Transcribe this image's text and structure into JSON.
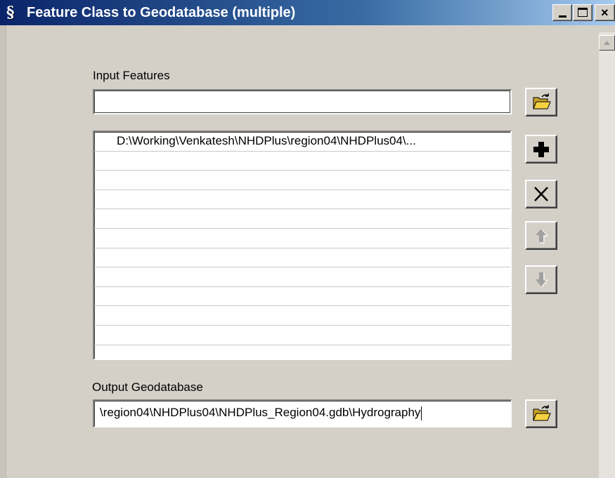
{
  "window": {
    "title": "Feature Class to Geodatabase (multiple)",
    "app_icon": "script-tool-icon",
    "controls": [
      "minimize",
      "maximize",
      "close"
    ]
  },
  "input_features": {
    "label": "Input Features",
    "value": "",
    "browse_icon": "open-folder-icon"
  },
  "features_list": {
    "items": [
      "D:\\Working\\Venkatesh\\NHDPlus\\region04\\NHDPlus04\\...",
      "",
      "",
      "",
      "",
      "",
      "",
      "",
      "",
      "",
      "",
      ""
    ]
  },
  "list_buttons": {
    "add_icon": "plus-icon",
    "remove_icon": "x-icon",
    "up_icon": "arrow-up-icon",
    "down_icon": "arrow-down-icon",
    "up_enabled": false,
    "down_enabled": false
  },
  "output_geodatabase": {
    "label": "Output Geodatabase",
    "value": "\\region04\\NHDPlus04\\NHDPlus_Region04.gdb\\Hydrography",
    "browse_icon": "open-folder-icon"
  },
  "colors": {
    "titlebar_start": "#0a246a",
    "titlebar_end": "#a6caf0",
    "dialog_face": "#d4d0c8",
    "folder_yellow": "#f5d142"
  }
}
